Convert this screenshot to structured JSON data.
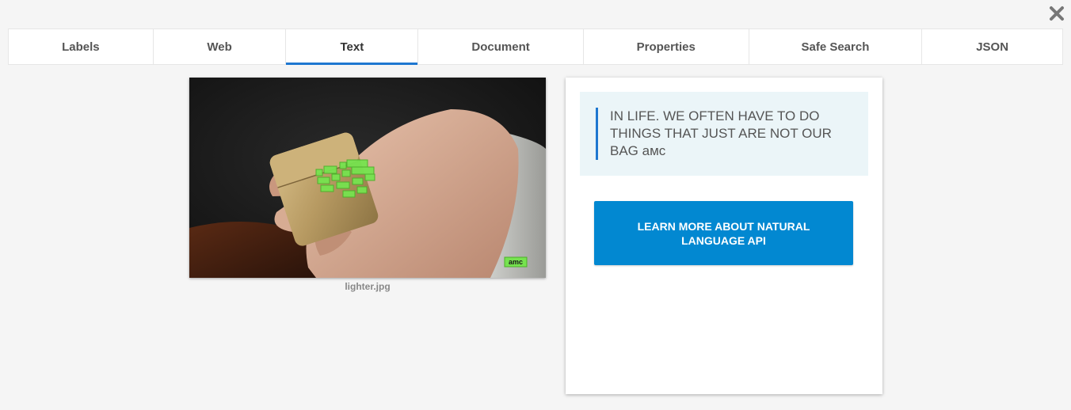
{
  "close": {
    "icon": "close-icon"
  },
  "tabs": [
    {
      "label": "Labels",
      "active": false
    },
    {
      "label": "Web",
      "active": false
    },
    {
      "label": "Text",
      "active": true
    },
    {
      "label": "Document",
      "active": false
    },
    {
      "label": "Properties",
      "active": false
    },
    {
      "label": "Safe Search",
      "active": false
    },
    {
      "label": "JSON",
      "active": false
    }
  ],
  "image": {
    "filename": "lighter.jpg",
    "watermark": "amc"
  },
  "result": {
    "detected_text": "IN LIFE. WE OFTEN HAVE TO DO\nTHINGS THAT JUST ARE NOT OUR\nBAG амс",
    "button_label": "LEARN MORE ABOUT NATURAL LANGUAGE API"
  },
  "colors": {
    "accent": "#1e77d0",
    "button": "#0288d1",
    "highlight_box": "#76e34f",
    "quote_background": "#ebf5f8"
  }
}
